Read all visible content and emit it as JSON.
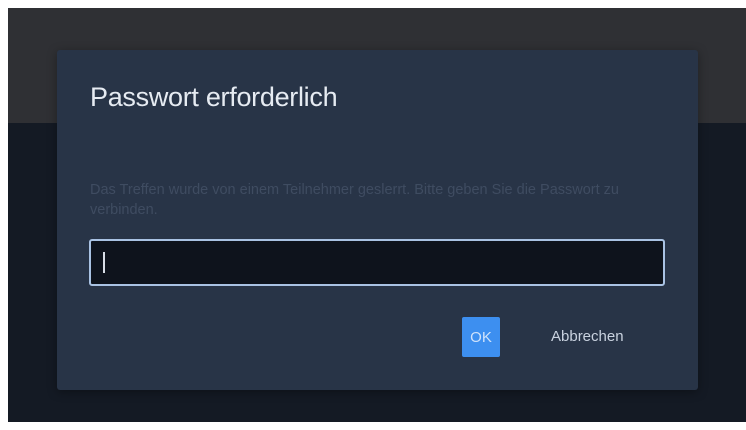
{
  "dialog": {
    "title": "Passwort erforderlich",
    "message": "Das Treffen wurde von einem Teilnehmer geslerrt. Bitte geben Sie die Passwort zu verbinden.",
    "password_value": "",
    "ok_label": "OK",
    "cancel_label": "Abbrechen"
  },
  "colors": {
    "background": "#141a24",
    "header": "#2f3034",
    "dialog": "#283447",
    "accent": "#3d8ff0",
    "input_border": "#a9c2e3"
  }
}
